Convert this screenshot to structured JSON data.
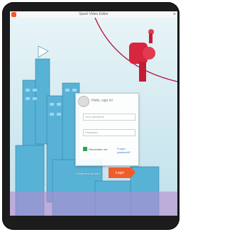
{
  "window": {
    "title": "Spark Video Editor",
    "close_glyph": "×"
  },
  "login": {
    "greeting": "Hello, sign in!",
    "username_placeholder": "Your username",
    "password_placeholder": "Password",
    "remember_label": "Remember me",
    "forgot_label": "Forgot password?",
    "create_account_label": "Create new account",
    "login_button_label": "Login"
  },
  "colors": {
    "accent": "#ef5b2b",
    "device_frame": "#1c1c1c",
    "sky": "#cfe6ee",
    "buildings": "#4aa7cf"
  },
  "icons": [
    "app-icon",
    "close-icon",
    "avatar-icon",
    "checkbox-icon"
  ]
}
